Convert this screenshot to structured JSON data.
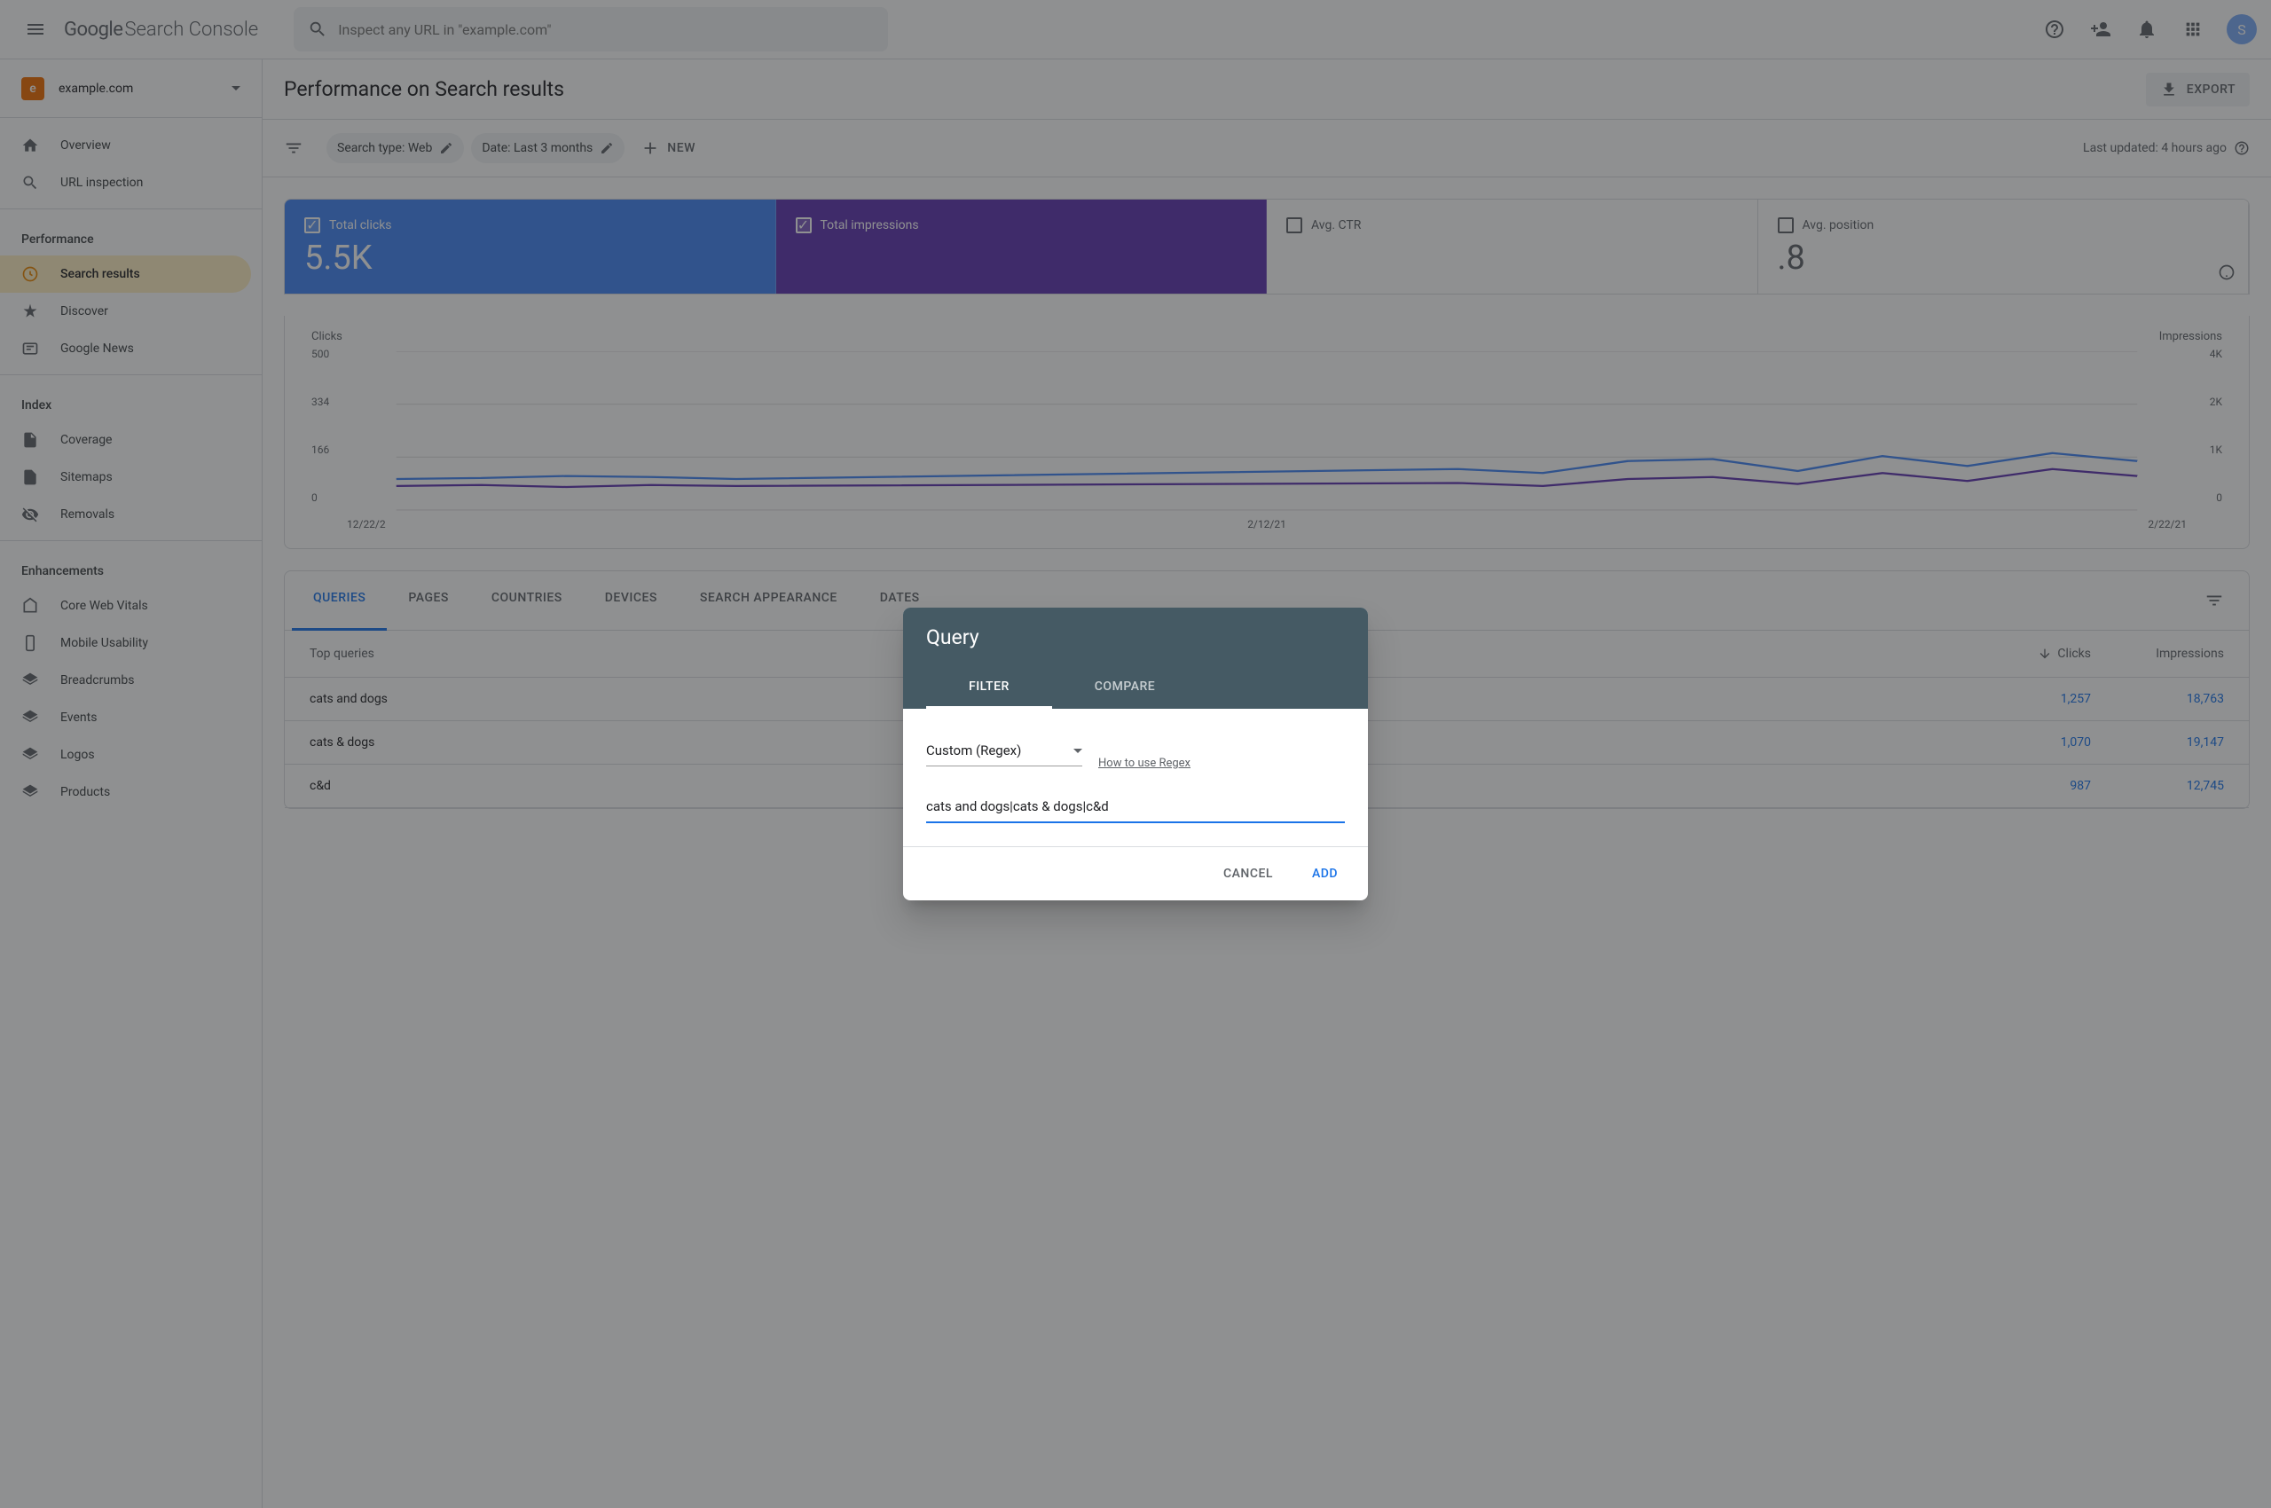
{
  "header": {
    "logo_google": "Google",
    "logo_sc": "Search Console",
    "search_placeholder": "Inspect any URL in \"example.com\"",
    "avatar_letter": "S"
  },
  "sidebar": {
    "property_letter": "e",
    "property_name": "example.com",
    "items_top": [
      {
        "label": "Overview",
        "icon": "home"
      },
      {
        "label": "URL inspection",
        "icon": "search"
      }
    ],
    "section_performance": "Performance",
    "items_performance": [
      {
        "label": "Search results",
        "icon": "google",
        "active": true
      },
      {
        "label": "Discover",
        "icon": "discover"
      },
      {
        "label": "Google News",
        "icon": "news"
      }
    ],
    "section_index": "Index",
    "items_index": [
      {
        "label": "Coverage",
        "icon": "coverage"
      },
      {
        "label": "Sitemaps",
        "icon": "sitemap"
      },
      {
        "label": "Removals",
        "icon": "removals"
      }
    ],
    "section_enhancements": "Enhancements",
    "items_enhancements": [
      {
        "label": "Core Web Vitals",
        "icon": "vitals"
      },
      {
        "label": "Mobile Usability",
        "icon": "mobile"
      },
      {
        "label": "Breadcrumbs",
        "icon": "breadcrumbs"
      },
      {
        "label": "Events",
        "icon": "events"
      },
      {
        "label": "Logos",
        "icon": "logos"
      },
      {
        "label": "Products",
        "icon": "products"
      }
    ]
  },
  "page": {
    "title": "Performance on Search results",
    "export": "EXPORT"
  },
  "filters": {
    "search_type": "Search type: Web",
    "date": "Date: Last 3 months",
    "new": "NEW",
    "last_updated": "Last updated: 4 hours ago"
  },
  "metrics": {
    "clicks_label": "Total clicks",
    "clicks_value": "5.5K",
    "impressions_label": "Total impressions",
    "ctr_label": "Avg. CTR",
    "position_label": "Avg. position",
    "position_partial": ".8"
  },
  "chart_data": {
    "type": "line",
    "y_left_label": "Clicks",
    "y_right_label": "Impressions",
    "y_left_ticks": [
      "500",
      "334",
      "166",
      "0"
    ],
    "y_right_ticks": [
      "4K",
      "2K",
      "1K",
      "0"
    ],
    "x_ticks": [
      "12/22/2",
      "2/12/21",
      "2/22/21"
    ],
    "series": [
      {
        "name": "Clicks",
        "color": "#4285f4",
        "visible_points": [
          50,
          55,
          52,
          48,
          50
        ]
      },
      {
        "name": "Impressions",
        "color": "#5e35b1",
        "visible_points": [
          400,
          420,
          600,
          900,
          1100,
          800,
          1200,
          900,
          1000,
          1300,
          950
        ]
      }
    ]
  },
  "tabs": {
    "items": [
      "QUERIES",
      "PAGES",
      "COUNTRIES",
      "DEVICES",
      "SEARCH APPEARANCE",
      "DATES"
    ],
    "active": 0
  },
  "table": {
    "header_query": "Top queries",
    "header_clicks": "Clicks",
    "header_impressions": "Impressions",
    "rows": [
      {
        "query": "cats and dogs",
        "clicks": "1,257",
        "impressions": "18,763"
      },
      {
        "query": "cats & dogs",
        "clicks": "1,070",
        "impressions": "19,147"
      },
      {
        "query": "c&d",
        "clicks": "987",
        "impressions": "12,745"
      }
    ]
  },
  "modal": {
    "title": "Query",
    "tab_filter": "FILTER",
    "tab_compare": "COMPARE",
    "select_value": "Custom (Regex)",
    "regex_link": "How to use Regex",
    "input_value": "cats and dogs|cats & dogs|c&d",
    "cancel": "CANCEL",
    "add": "ADD"
  }
}
